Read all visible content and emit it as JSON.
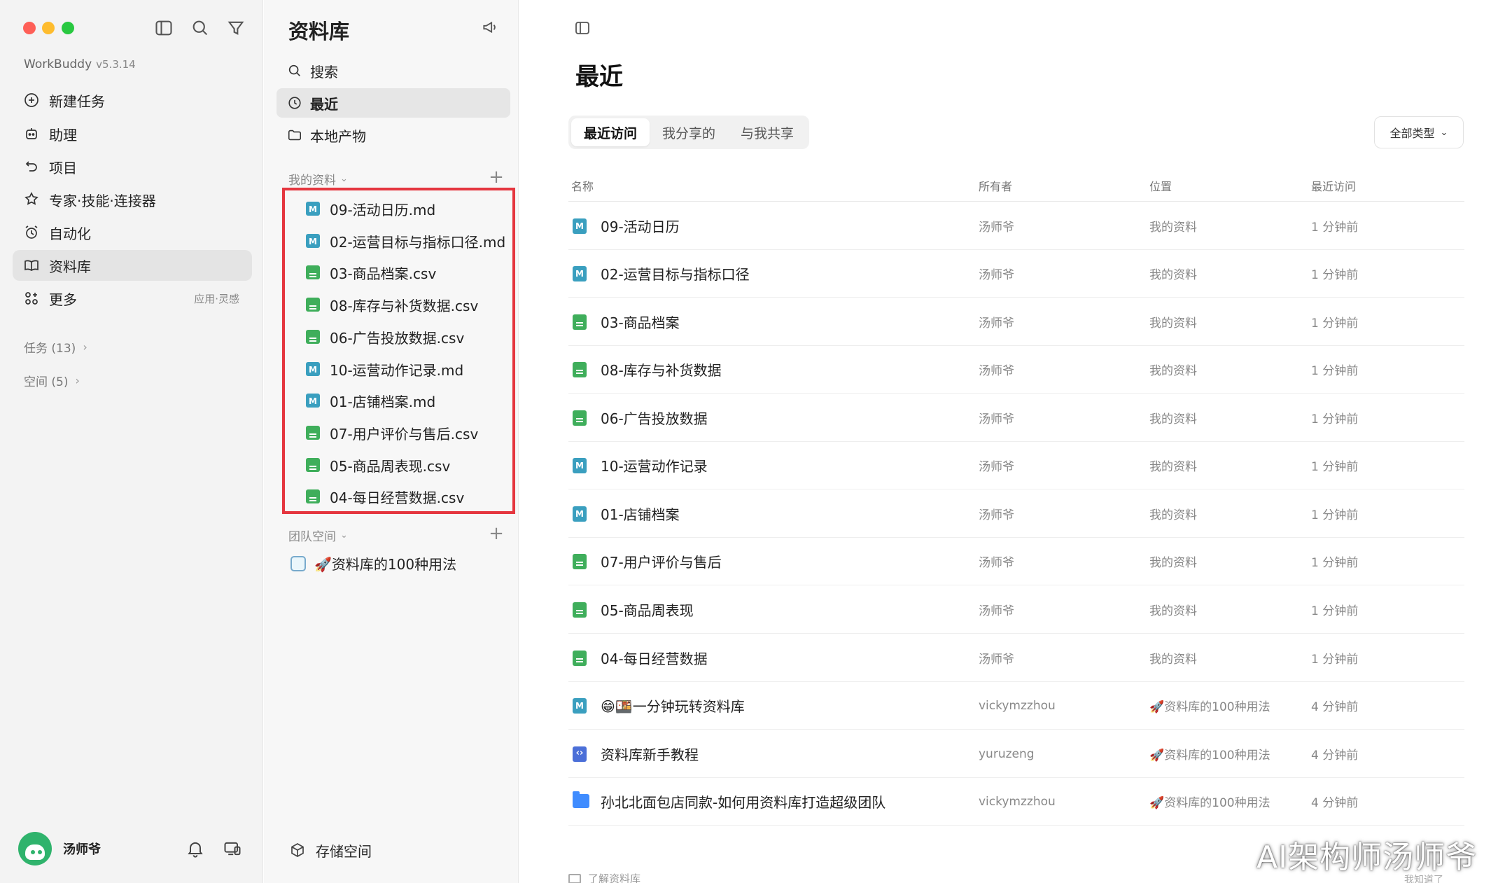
{
  "app": {
    "name": "WorkBuddy",
    "version": "v5.3.14"
  },
  "nav": {
    "items": [
      {
        "label": "新建任务",
        "icon": "plus-circle-icon"
      },
      {
        "label": "助理",
        "icon": "robot-icon"
      },
      {
        "label": "项目",
        "icon": "project-icon"
      },
      {
        "label": "专家·技能·连接器",
        "icon": "expert-icon"
      },
      {
        "label": "自动化",
        "icon": "alarm-icon"
      },
      {
        "label": "资料库",
        "icon": "book-icon",
        "active": true
      },
      {
        "label": "更多",
        "icon": "grid-plus-icon",
        "right": "应用·灵感"
      }
    ],
    "tasks": "任务 (13)",
    "spaces": "空间 (5)",
    "user": "汤师爷"
  },
  "library": {
    "title": "资料库",
    "items": [
      {
        "label": "搜索",
        "icon": "search-icon"
      },
      {
        "label": "最近",
        "icon": "clock-icon",
        "active": true
      },
      {
        "label": "本地产物",
        "icon": "folder-icon"
      }
    ],
    "my_section": "我的资料",
    "my_files": [
      {
        "name": "09-活动日历.md",
        "type": "md"
      },
      {
        "name": "02-运营目标与指标口径.md",
        "type": "md"
      },
      {
        "name": "03-商品档案.csv",
        "type": "csv"
      },
      {
        "name": "08-库存与补货数据.csv",
        "type": "csv"
      },
      {
        "name": "06-广告投放数据.csv",
        "type": "csv"
      },
      {
        "name": "10-运营动作记录.md",
        "type": "md"
      },
      {
        "name": "01-店铺档案.md",
        "type": "md"
      },
      {
        "name": "07-用户评价与售后.csv",
        "type": "csv"
      },
      {
        "name": "05-商品周表现.csv",
        "type": "csv"
      },
      {
        "name": "04-每日经营数据.csv",
        "type": "csv"
      }
    ],
    "team_section": "团队空间",
    "team_items": [
      {
        "name": "🚀资料库的100种用法"
      }
    ],
    "storage": "存储空间"
  },
  "main": {
    "title": "最近",
    "tabs": [
      {
        "label": "最近访问",
        "active": true
      },
      {
        "label": "我分享的"
      },
      {
        "label": "与我共享"
      }
    ],
    "filter": "全部类型",
    "columns": {
      "name": "名称",
      "owner": "所有者",
      "location": "位置",
      "time": "最近访问"
    },
    "rows": [
      {
        "name": "09-活动日历",
        "type": "md",
        "owner": "汤师爷",
        "location": "我的资料",
        "time": "1 分钟前"
      },
      {
        "name": "02-运营目标与指标口径",
        "type": "md",
        "owner": "汤师爷",
        "location": "我的资料",
        "time": "1 分钟前"
      },
      {
        "name": "03-商品档案",
        "type": "csv",
        "owner": "汤师爷",
        "location": "我的资料",
        "time": "1 分钟前"
      },
      {
        "name": "08-库存与补货数据",
        "type": "csv",
        "owner": "汤师爷",
        "location": "我的资料",
        "time": "1 分钟前"
      },
      {
        "name": "06-广告投放数据",
        "type": "csv",
        "owner": "汤师爷",
        "location": "我的资料",
        "time": "1 分钟前"
      },
      {
        "name": "10-运营动作记录",
        "type": "md",
        "owner": "汤师爷",
        "location": "我的资料",
        "time": "1 分钟前"
      },
      {
        "name": "01-店铺档案",
        "type": "md",
        "owner": "汤师爷",
        "location": "我的资料",
        "time": "1 分钟前"
      },
      {
        "name": "07-用户评价与售后",
        "type": "csv",
        "owner": "汤师爷",
        "location": "我的资料",
        "time": "1 分钟前"
      },
      {
        "name": "05-商品周表现",
        "type": "csv",
        "owner": "汤师爷",
        "location": "我的资料",
        "time": "1 分钟前"
      },
      {
        "name": "04-每日经营数据",
        "type": "csv",
        "owner": "汤师爷",
        "location": "我的资料",
        "time": "1 分钟前"
      },
      {
        "name": "😁🍱一分钟玩转资料库",
        "type": "md",
        "owner": "vickymzzhou",
        "location": "🚀资料库的100种用法",
        "time": "4 分钟前"
      },
      {
        "name": "资料库新手教程",
        "type": "code",
        "owner": "yuruzeng",
        "location": "🚀资料库的100种用法",
        "time": "4 分钟前"
      },
      {
        "name": "孙北北面包店同款-如何用资料库打造超级团队",
        "type": "folder",
        "owner": "vickymzzhou",
        "location": "🚀资料库的100种用法",
        "time": "4 分钟前"
      }
    ],
    "footer_hint": "了解资料库",
    "footer_got": "我知道了"
  },
  "watermark": "AI架构师汤师爷",
  "colors": {
    "highlight": "#e5363f",
    "md": "#3a9fbf",
    "csv": "#3fae5b"
  }
}
